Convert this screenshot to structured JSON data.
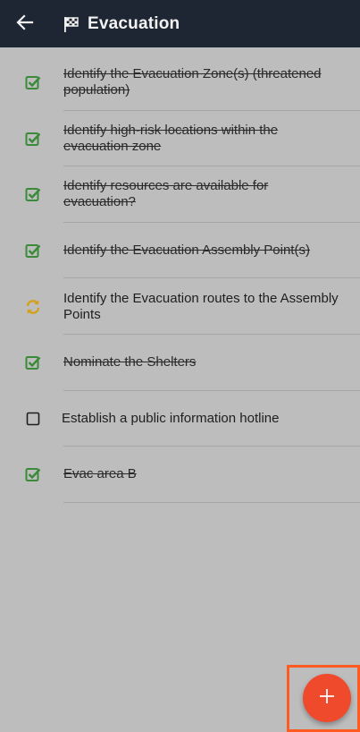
{
  "header": {
    "title": "Evacuation",
    "back_icon": "arrow-left-icon",
    "title_icon": "flag-icon"
  },
  "colors": {
    "appbar": "#1f2633",
    "background": "#bdbdbd",
    "done": "#3a8a3a",
    "in_progress": "#d4a017",
    "fab": "#ef4a2b"
  },
  "tasks": [
    {
      "label": "Identify the Evacuation Zone(s) (threatened population)",
      "status": "done"
    },
    {
      "label": "Identify high-risk locations within the evacuation zone",
      "status": "done"
    },
    {
      "label": "Identify resources are available for evacuation?",
      "status": "done"
    },
    {
      "label": "Identify the Evacuation Assembly Point(s)",
      "status": "done"
    },
    {
      "label": "Identify the Evacuation routes to the Assembly Points",
      "status": "in_progress"
    },
    {
      "label": "Nominate the Shelters",
      "status": "done"
    },
    {
      "label": "Establish a public information hotline",
      "status": "todo"
    },
    {
      "label": "Evac area B",
      "status": "done"
    }
  ],
  "fab": {
    "icon": "plus-icon"
  }
}
